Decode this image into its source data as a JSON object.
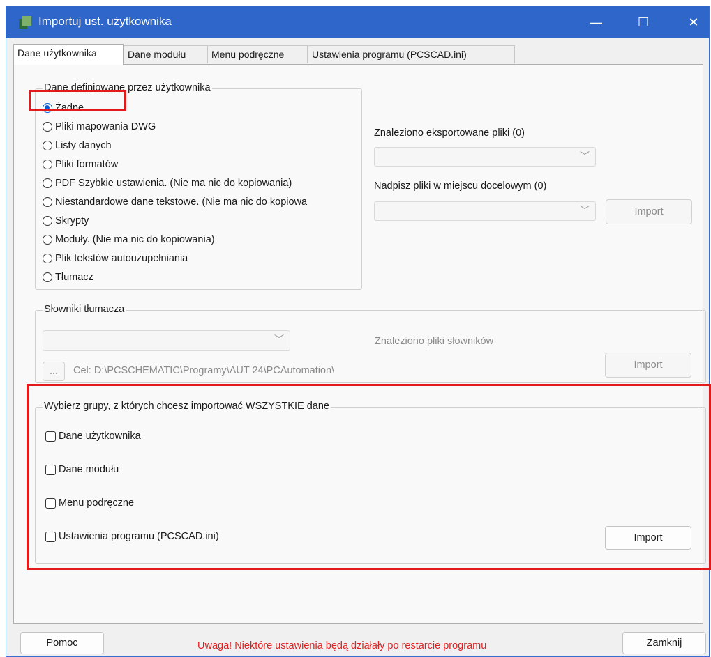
{
  "window": {
    "title": "Importuj ust. użytkownika",
    "minimize_glyph": "—",
    "maximize_glyph": "☐",
    "close_glyph": "✕"
  },
  "tabs": [
    {
      "label": "Dane użytkownika"
    },
    {
      "label": "Dane modułu"
    },
    {
      "label": "Menu podręczne"
    },
    {
      "label": "Ustawienia programu (PCSCAD.ini)"
    }
  ],
  "user_data_group": {
    "title": "Dane definiowane przez użytkownika",
    "options": [
      {
        "label": "Żadne",
        "checked": true
      },
      {
        "label": "Pliki mapowania DWG",
        "checked": false
      },
      {
        "label": "Listy danych",
        "checked": false
      },
      {
        "label": "Pliki formatów",
        "checked": false
      },
      {
        "label": "PDF Szybkie ustawienia. (Nie ma nic do kopiowania)",
        "checked": false
      },
      {
        "label": "Niestandardowe dane tekstowe. (Nie ma nic do kopiowa",
        "checked": false
      },
      {
        "label": "Skrypty",
        "checked": false
      },
      {
        "label": "Moduły. (Nie ma nic do kopiowania)",
        "checked": false
      },
      {
        "label": "Plik tekstów autouzupełniania",
        "checked": false
      },
      {
        "label": "Tłumacz",
        "checked": false
      }
    ]
  },
  "exported": {
    "found_label": "Znaleziono eksportowane pliki (0)",
    "overwrite_label": "Nadpisz pliki w miejscu docelowym (0)",
    "import_label": "Import"
  },
  "dictionaries": {
    "title": "Słowniki tłumacza",
    "found_label": "Znaleziono pliki słowników",
    "browse_label": "...",
    "target_label": "Cel: D:\\PCSCHEMATIC\\Programy\\AUT 24\\PCAutomation\\",
    "import_label": "Import"
  },
  "groups": {
    "title": "Wybierz grupy, z których chcesz importować WSZYSTKIE dane",
    "items": [
      {
        "label": "Dane użytkownika",
        "checked": false
      },
      {
        "label": "Dane modułu",
        "checked": false
      },
      {
        "label": "Menu podręczne",
        "checked": false
      },
      {
        "label": "Ustawienia programu (PCSCAD.ini)",
        "checked": false
      }
    ],
    "import_label": "Import"
  },
  "footer": {
    "help_label": "Pomoc",
    "warning": "Uwaga! Niektóre ustawienia będą działały po restarcie programu",
    "close_label": "Zamknij"
  },
  "colors": {
    "titlebar": "#2f66c9",
    "highlight": "#e21a1a",
    "warning_text": "#e02020",
    "radio_accent": "#0b5fd0"
  }
}
